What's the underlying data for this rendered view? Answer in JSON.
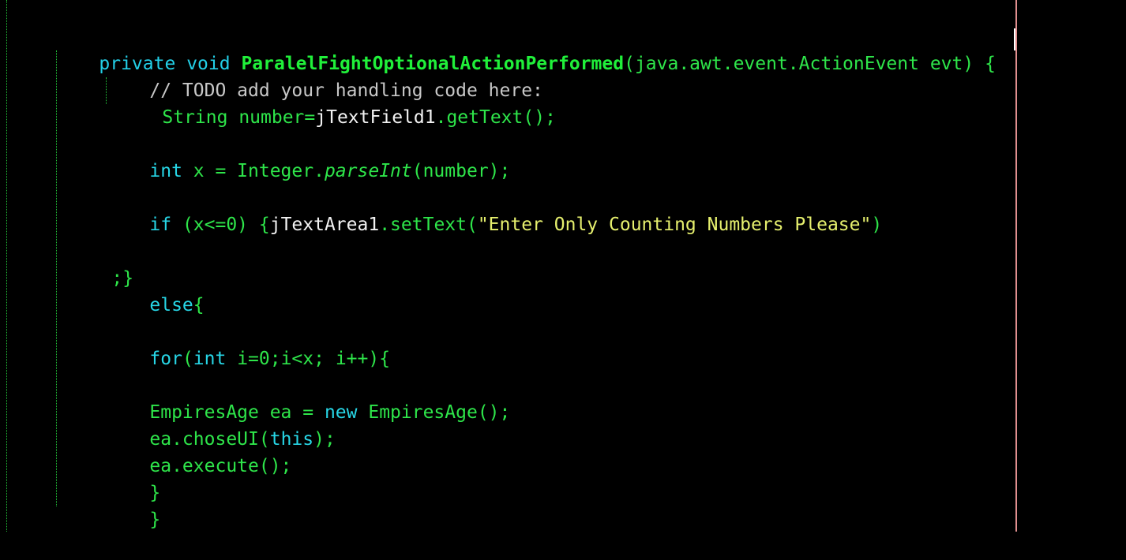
{
  "code": {
    "line1": {
      "kw_private": "private",
      "kw_void": "void",
      "method_name": "ParalelFightOptionalActionPerformed",
      "params_open": "(java.awt.event.ActionEvent ",
      "param_name": "evt) {"
    },
    "line2": {
      "comment": "// TODO add your handling code here:"
    },
    "line3": {
      "type": "String number=",
      "obj": "jTextField1",
      "call": ".getText();"
    },
    "line4": {
      "kw_int": "int",
      "decl": " x = Integer.",
      "method_italic": "parseInt",
      "rest": "(number);"
    },
    "line5": {
      "kw_if": "if",
      "cond": " (x<=0) {",
      "obj": "jTextArea1",
      "call": ".setText(",
      "string": "\"Enter Only Counting Numbers Please\"",
      "close": ")"
    },
    "line6": {
      "text": ";}"
    },
    "line7": {
      "kw_else": "else",
      "brace": "{"
    },
    "line8": {
      "kw_for": "for",
      "open": "(",
      "kw_int": "int",
      "rest": " i=0;i<x; i++){"
    },
    "line9": {
      "decl": "EmpiresAge ea = ",
      "kw_new": "new",
      "rest": " EmpiresAge();"
    },
    "line10": {
      "obj": "ea.choseUI(",
      "kw_this": "this",
      "rest": ");"
    },
    "line11": {
      "text": "ea.execute();"
    },
    "line12": {
      "text": "}"
    },
    "line13": {
      "text": "}"
    }
  }
}
